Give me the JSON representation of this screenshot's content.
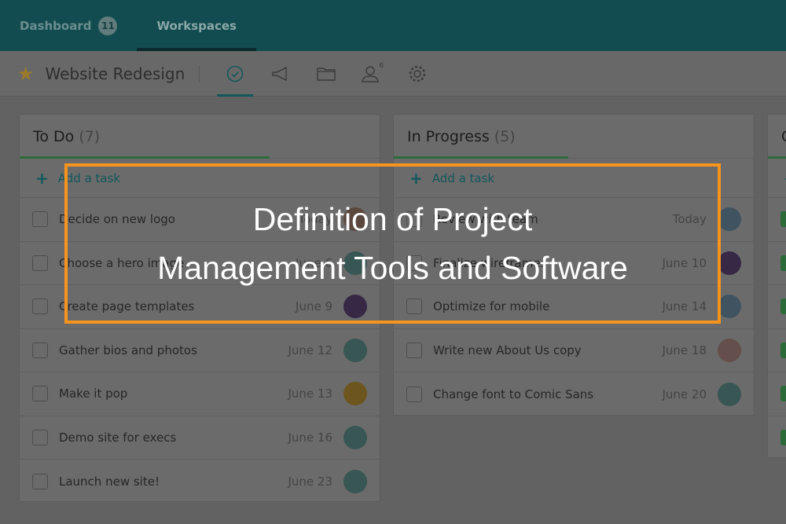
{
  "nav": {
    "tabs": [
      {
        "label": "Dashboard",
        "badge": "11"
      },
      {
        "label": "Workspaces"
      }
    ]
  },
  "project": {
    "name": "Website Redesign",
    "icons": [
      "star-icon",
      "check-circle-icon",
      "megaphone-icon",
      "folder-icon",
      "user-icon",
      "gear-icon"
    ],
    "members_count": "6"
  },
  "columns": [
    {
      "title": "To Do",
      "count": "(7)",
      "add_label": "Add a task",
      "tasks": [
        {
          "name": "Decide on new logo",
          "date": "Today",
          "avatar_color": "#c9a08a"
        },
        {
          "name": "Choose a hero image",
          "date": "June 6",
          "avatar_color": "#7cc0b8"
        },
        {
          "name": "Create page templates",
          "date": "June 9",
          "avatar_color": "#7a5a9a"
        },
        {
          "name": "Gather bios and photos",
          "date": "June 12",
          "avatar_color": "#7cc0b8"
        },
        {
          "name": "Make it pop",
          "date": "June 13",
          "avatar_color": "#f0c040"
        },
        {
          "name": "Demo site for execs",
          "date": "June 16",
          "avatar_color": "#7cc0b8"
        },
        {
          "name": "Launch new site!",
          "date": "June 23",
          "avatar_color": "#7cc0b8"
        }
      ]
    },
    {
      "title": "In Progress",
      "count": "(5)",
      "add_label": "Add a task",
      "tasks": [
        {
          "name": "Review with team",
          "date": "Today",
          "avatar_color": "#8fb8d8"
        },
        {
          "name": "Finalize wireframes",
          "date": "June 10",
          "avatar_color": "#7a5a9a"
        },
        {
          "name": "Optimize for mobile",
          "date": "June 14",
          "avatar_color": "#8fb8d8"
        },
        {
          "name": "Write new About Us copy",
          "date": "June 18",
          "avatar_color": "#e0b0a8"
        },
        {
          "name": "Change font to Comic Sans",
          "date": "June 20",
          "avatar_color": "#7cc0b8"
        }
      ]
    },
    {
      "title": "C",
      "done_rows": 6
    }
  ],
  "overlay": {
    "title_line1": "Definition of Project",
    "title_line2": "Management Tools and Software",
    "frame_color": "#f7941d"
  }
}
